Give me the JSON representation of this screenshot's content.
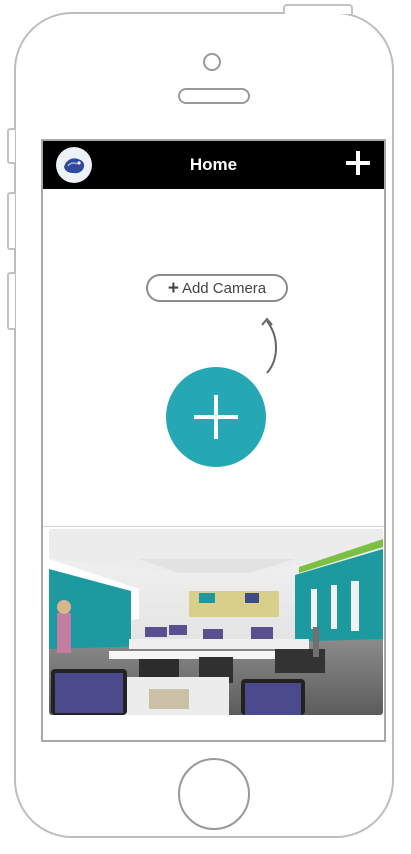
{
  "header": {
    "title": "Home",
    "add_icon": "plus-icon",
    "avatar_icon": "logo-icon"
  },
  "main": {
    "add_camera_label": "Add Camera",
    "fab_icon": "plus-icon",
    "hint_icon": "curved-arrow-icon"
  },
  "colors": {
    "navbar": "#000000",
    "accent": "#25a8b4",
    "teal_wall": "#1c9aa0",
    "green_trim": "#7bc043"
  }
}
